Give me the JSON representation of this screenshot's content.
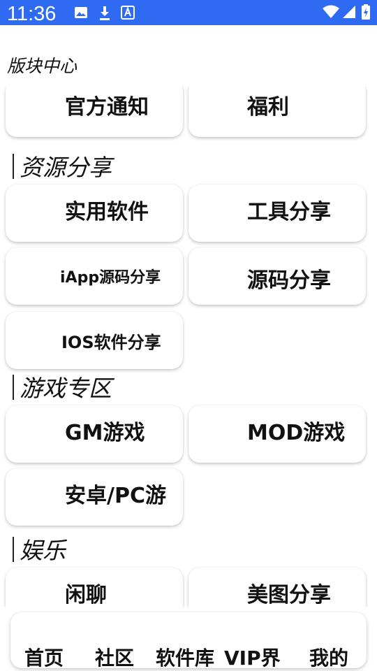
{
  "status_bar": {
    "time": "11:36",
    "icons": [
      "image-icon",
      "download-icon",
      "font-icon",
      "wifi-icon",
      "signal-icon",
      "battery-icon"
    ],
    "background": "#2f6bf2"
  },
  "page_title": "版块中心",
  "top_cards": [
    "官方通知",
    "福利"
  ],
  "sections": [
    {
      "title": "资源分享",
      "items": [
        "实用软件",
        "工具分享",
        "iApp源码分享",
        "源码分享",
        "IOS软件分享"
      ]
    },
    {
      "title": "游戏专区",
      "items": [
        "GM游戏",
        "MOD游戏",
        "安卓/PC游"
      ]
    },
    {
      "title": "娱乐",
      "items": [
        "闲聊",
        "美图分享"
      ]
    }
  ],
  "bottom_nav": [
    "首页",
    "社区",
    "软件库",
    "VIP界",
    "我的"
  ]
}
